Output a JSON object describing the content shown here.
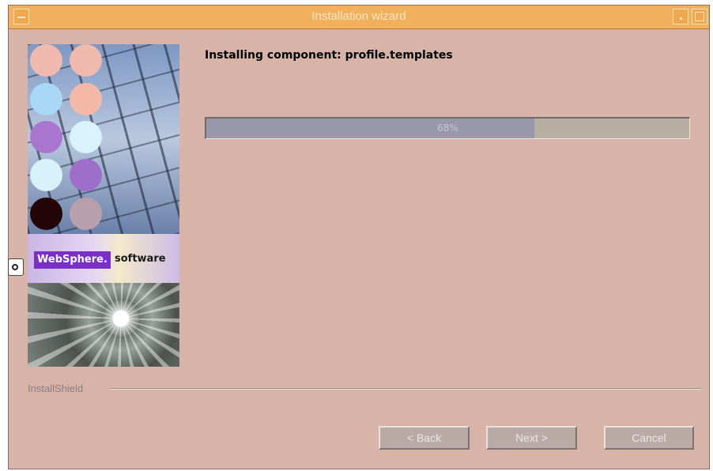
{
  "window": {
    "title": "Installation wizard"
  },
  "side_panel": {
    "logo_text": "WebSphere.",
    "logo_suffix": "software",
    "circle_colors": [
      "#f0b9ae",
      "#f0b9ae",
      "#a9d8f7",
      "#f3b8a7",
      "#a876cf",
      "#d8f3fb",
      "#d7f2fb",
      "#9e6fc8",
      "#230507",
      "#b7a0ab"
    ]
  },
  "main": {
    "status_text": "Installing component: profile.templates",
    "progress": {
      "value_percent": 68,
      "label": "68%"
    }
  },
  "footer": {
    "brand": "InstallShield"
  },
  "buttons": {
    "back": "< Back",
    "next": "Next >",
    "cancel": "Cancel"
  },
  "colors": {
    "title_bar": "#f2b05c",
    "window_bg": "#d7b3a8",
    "progress_fill": "#9897ab",
    "progress_track": "#b8aea2"
  }
}
